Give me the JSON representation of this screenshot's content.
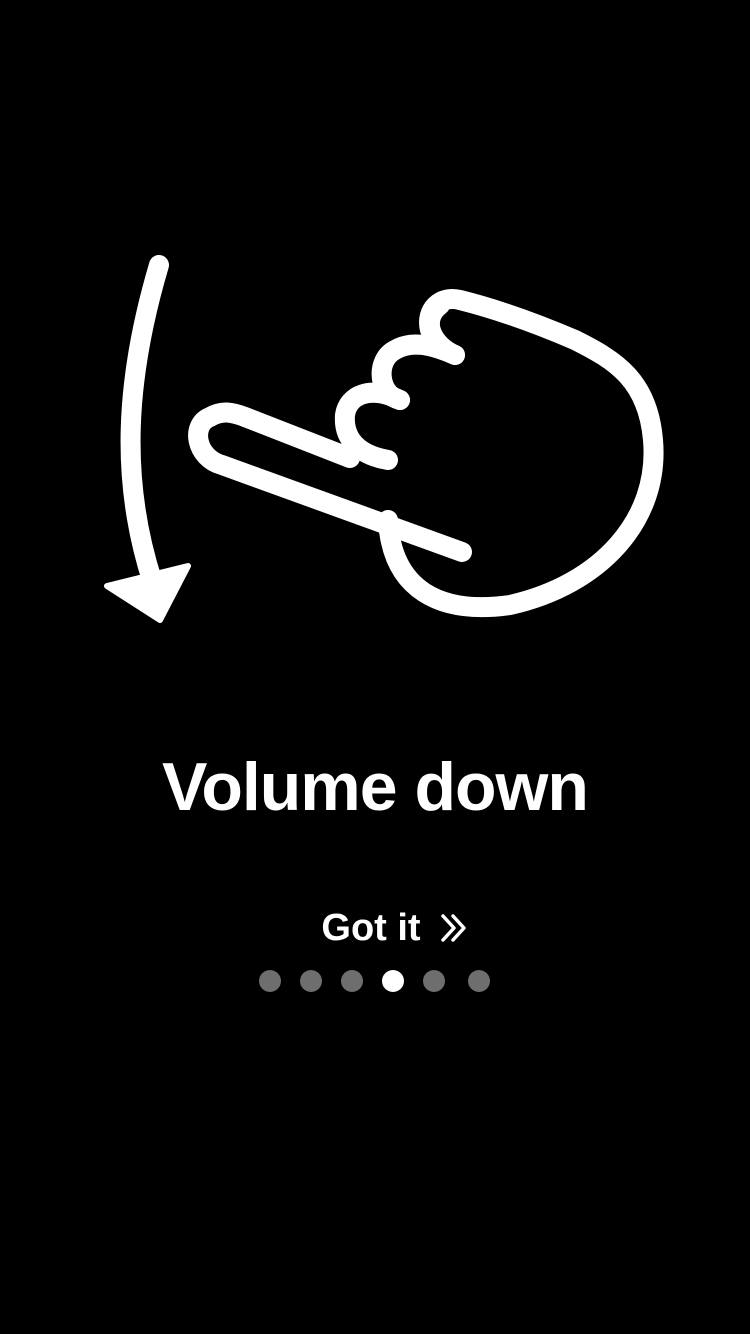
{
  "gesture": {
    "title": "Volume down",
    "icons": [
      "arrow-down-curve-icon",
      "pointing-hand-icon"
    ]
  },
  "action": {
    "label": "Got it",
    "icon": "double-chevron-right-icon"
  },
  "pager": {
    "total": 6,
    "current_index": 3
  },
  "colors": {
    "background": "#000000",
    "foreground": "#ffffff",
    "dot_inactive": "#6e6e6e"
  }
}
